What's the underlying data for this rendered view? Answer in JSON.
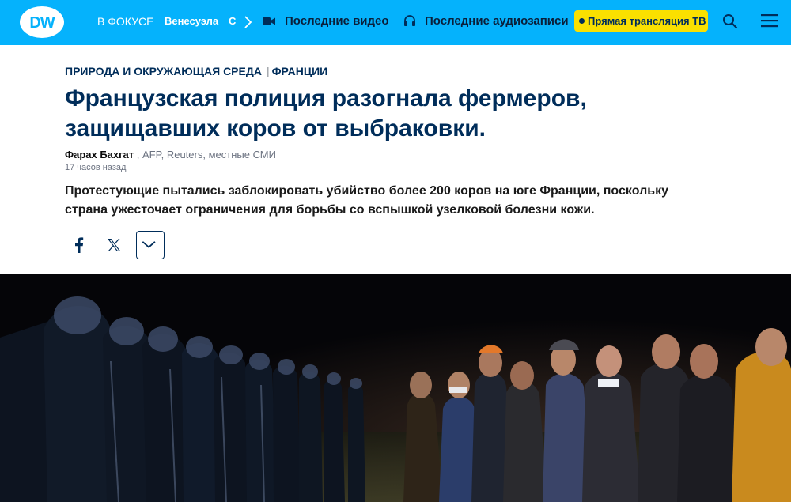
{
  "header": {
    "logo_text": "DW",
    "focus_label": "В ФОКУСЕ",
    "topics": [
      "Венесуэла",
      "С"
    ],
    "video_label": "Последние видео",
    "audio_label": "Последние аудиозаписи",
    "live_label": "Прямая трансляция ТВ",
    "icons": [
      "chevron-right-icon",
      "video-camera-icon",
      "headphones-icon",
      "search-icon",
      "menu-icon"
    ]
  },
  "article": {
    "category": "ПРИРОДА И ОКРУЖАЮЩАЯ СРЕДА",
    "region": "ФРАНЦИИ",
    "headline": "Французская полиция разогнала фермеров, защищавших коров от выбраковки.",
    "author": "Фарах Бахгат",
    "sources": ", AFP, Reuters, местные СМИ",
    "time_ago": "17 часов назад",
    "lead": "Протестующие пытались заблокировать убийство более 200 коров на юге Франции, поскольку страна ужесточает ограничения для борьбы со вспышкой узелковой болезни кожи."
  },
  "share": {
    "icons": [
      "facebook-icon",
      "x-icon",
      "chevron-down-icon"
    ]
  },
  "colors": {
    "brand_blue": "#05b2fc",
    "navy": "#002d5a",
    "live_yellow": "#fae000"
  }
}
